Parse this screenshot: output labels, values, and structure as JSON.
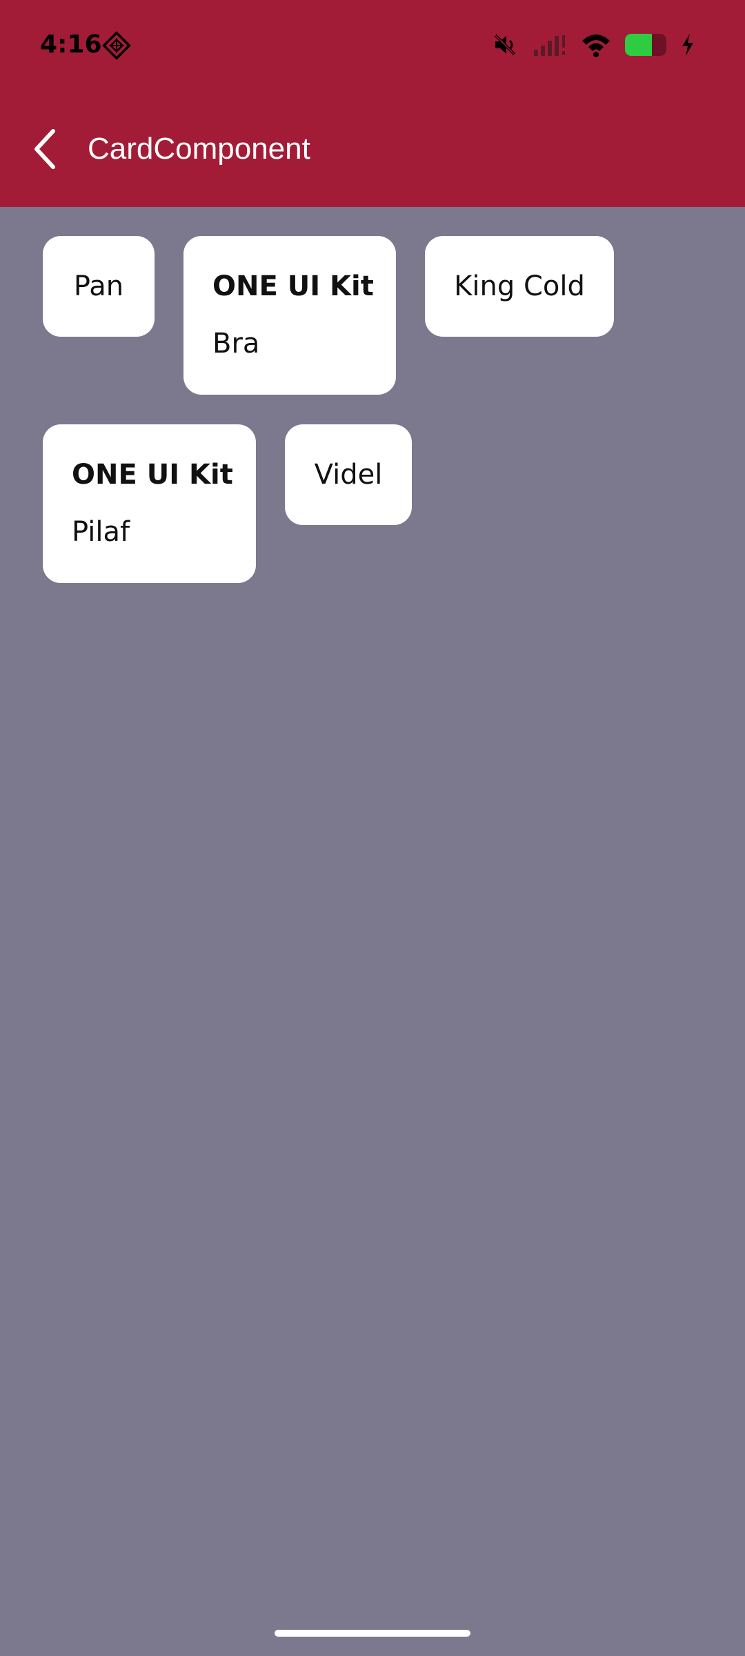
{
  "status_bar": {
    "time": "4:16",
    "left_icon": "notification-diamond-icon",
    "right_icons": [
      "mute-icon",
      "signal-icon",
      "wifi-icon",
      "battery-icon",
      "charging-bolt-icon"
    ],
    "battery_level": 0.65
  },
  "app_bar": {
    "back_icon": "back-chevron-icon",
    "title": "CardComponent",
    "background_color": "#a31c37"
  },
  "content": {
    "background_color": "#7c788d",
    "cards": [
      {
        "label": "Pan"
      },
      {
        "title": "ONE UI Kit",
        "subtitle": "Bra"
      },
      {
        "label": "King Cold"
      },
      {
        "title": "ONE UI Kit",
        "subtitle": "Pilaf"
      },
      {
        "label": "Videl"
      }
    ]
  }
}
